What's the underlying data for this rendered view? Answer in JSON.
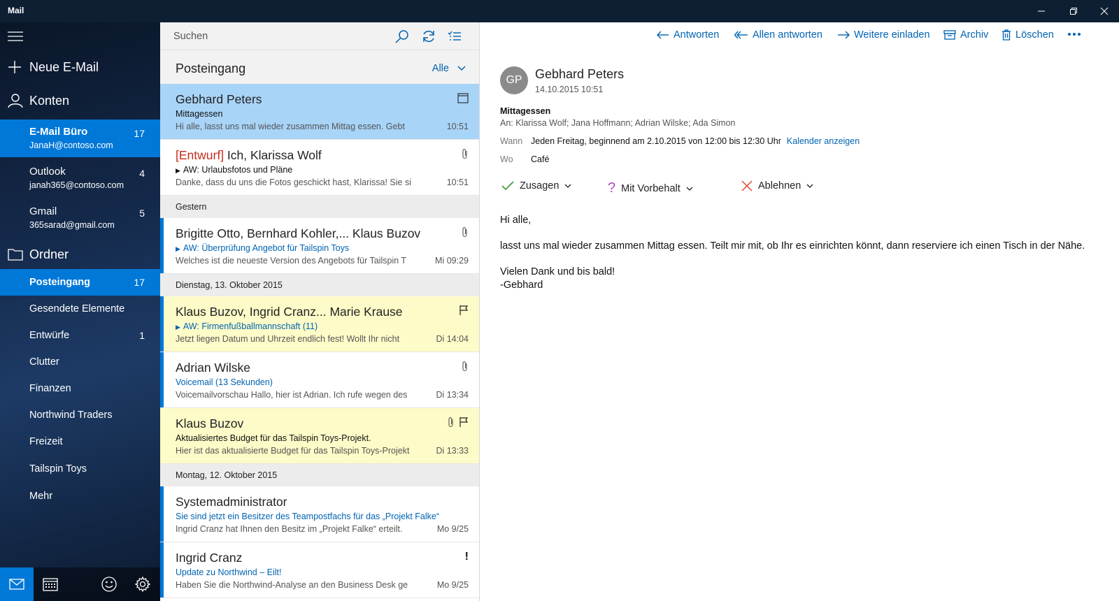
{
  "window": {
    "title": "Mail"
  },
  "sidebar": {
    "new_mail": "Neue E-Mail",
    "accounts_label": "Konten",
    "accounts": [
      {
        "name": "E-Mail Büro",
        "email": "JanaH@contoso.com",
        "count": "17"
      },
      {
        "name": "Outlook",
        "email": "janah365@contoso.com",
        "count": "4"
      },
      {
        "name": "Gmail",
        "email": "365sarad@gmail.com",
        "count": "5"
      }
    ],
    "folders_label": "Ordner",
    "folders": [
      {
        "name": "Posteingang",
        "count": "17"
      },
      {
        "name": "Gesendete Elemente",
        "count": ""
      },
      {
        "name": "Entwürfe",
        "count": "1"
      },
      {
        "name": "Clutter",
        "count": ""
      },
      {
        "name": "Finanzen",
        "count": ""
      },
      {
        "name": "Northwind Traders",
        "count": ""
      },
      {
        "name": "Freizeit",
        "count": ""
      },
      {
        "name": "Tailspin Toys",
        "count": ""
      },
      {
        "name": "Mehr",
        "count": ""
      }
    ]
  },
  "list": {
    "search_placeholder": "Suchen",
    "folder_title": "Posteingang",
    "filter": "Alle",
    "groups": [
      "Gestern",
      "Dienstag, 13. Oktober 2015",
      "Montag, 12. Oktober 2015"
    ],
    "messages": [
      {
        "from": "Gebhard Peters",
        "subject": "Mittagessen",
        "preview": "Hi alle, lasst uns mal wieder zusammen Mittag essen. Gebt",
        "time": "10:51"
      },
      {
        "draft": "[Entwurf]",
        "from": " Ich, Klarissa Wolf",
        "subject": "AW: Urlaubsfotos und Pläne",
        "preview": "Danke, dass du uns die Fotos geschickt hast, Klarissa! Sie si",
        "time": "10:51"
      },
      {
        "from": "Brigitte Otto, Bernhard Kohler,... Klaus Buzov",
        "subject": "AW: Überprüfung Angebot für Tailspin Toys",
        "preview": "Welches ist die neueste Version des Angebots für Tailspin T",
        "time": "Mi 09:29"
      },
      {
        "from": "Klaus Buzov, Ingrid Cranz... Marie Krause",
        "subject": "AW: Firmenfußballmannschaft (11)",
        "preview": "Jetzt liegen Datum und Uhrzeit endlich fest! Wollt Ihr nicht",
        "time": "Di 14:04"
      },
      {
        "from": "Adrian Wilske",
        "subject": "Voicemail (13 Sekunden)",
        "preview": "Voicemailvorschau Hallo, hier ist Adrian. Ich rufe wegen des",
        "time": "Di 13:34"
      },
      {
        "from": "Klaus Buzov",
        "subject": "Aktualisiertes Budget für das Tailspin Toys-Projekt.",
        "preview": "Hier ist das aktualisierte Budget für das Tailspin Toys-Projekt",
        "time": "Di 13:33"
      },
      {
        "from": "Systemadministrator",
        "subject": "Sie sind jetzt ein Besitzer des Teampostfachs für das „Projekt Falke“",
        "preview": "Ingrid Cranz hat Ihnen den Besitz im „Projekt Falke“ erteilt.",
        "time": "Mo 9/25"
      },
      {
        "from": "Ingrid Cranz",
        "subject": "Update zu Northwind – Eilt!",
        "preview": "Haben Sie die Northwind-Analyse an den Business Desk ge",
        "time": "Mo 9/25",
        "importance": "!"
      }
    ]
  },
  "toolbar": {
    "reply": "Antworten",
    "reply_all": "Allen antworten",
    "invite": "Weitere einladen",
    "archive": "Archiv",
    "delete": "Löschen"
  },
  "reading": {
    "initials": "GP",
    "sender": "Gebhard Peters",
    "date": "14.10.2015 10:51",
    "subject": "Mittagessen",
    "to": "An: Klarissa Wolf; Jana Hoffmann; Adrian Wilske; Ada Simon",
    "when_label": "Wann",
    "when": "Jeden Freitag, beginnend am 2.10.2015 von 12:00 bis 12:30 Uhr",
    "calendar_link": "Kalender anzeigen",
    "where_label": "Wo",
    "where": "Café",
    "accept": "Zusagen",
    "tentative": "Mit Vorbehalt",
    "decline": "Ablehnen",
    "body": [
      "Hi alle,",
      "lasst uns mal wieder zusammen Mittag essen. Teilt mir mit, ob Ihr es einrichten könnt, dann reserviere ich einen Tisch in der Nähe.",
      "Vielen Dank und bis bald!",
      "-Gebhard"
    ]
  },
  "colors": {
    "accent": "#0078d7",
    "link": "#0063b1",
    "selected_item": "#a8d4f8",
    "flagged": "#fdfbc8",
    "titlebar": "#0e1f33"
  }
}
